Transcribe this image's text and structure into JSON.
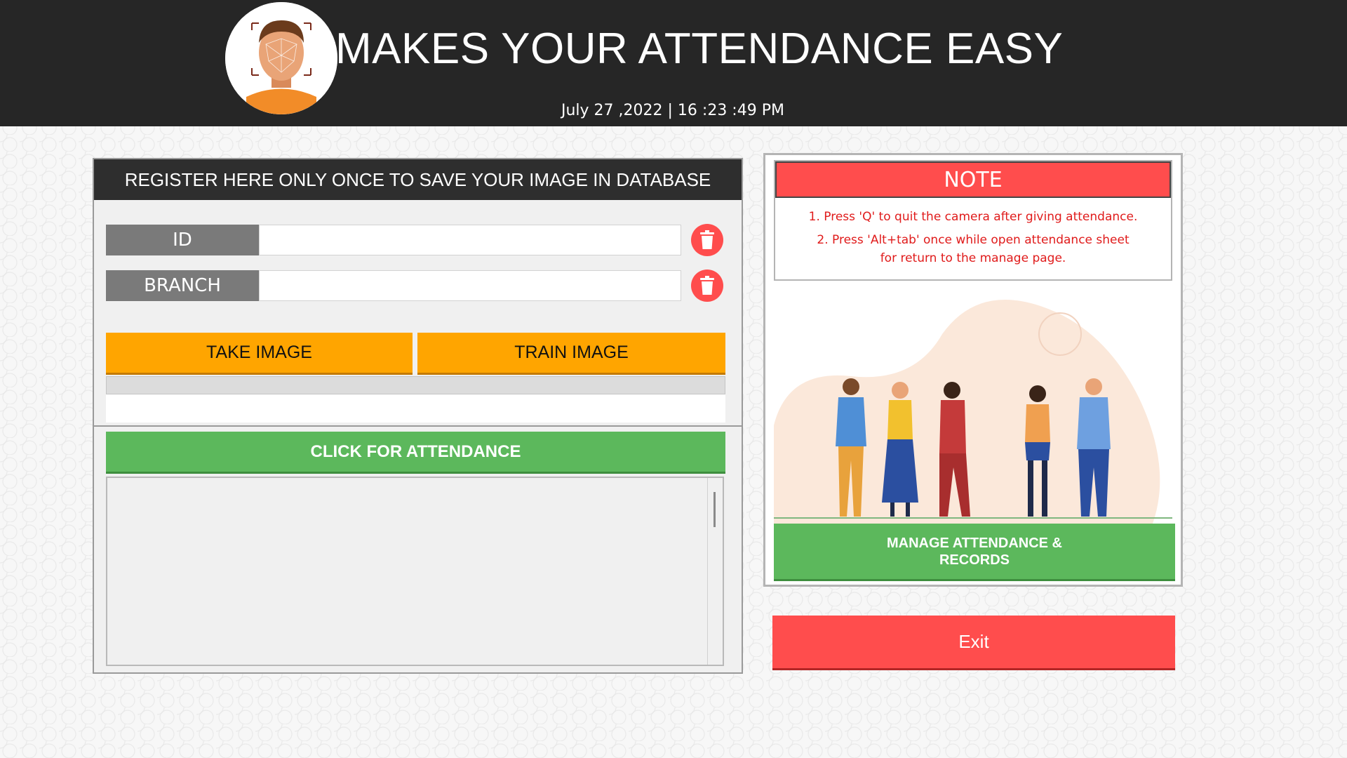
{
  "header": {
    "title": "MAKES YOUR ATTENDANCE EASY",
    "datetime": "July 27 ,2022 | 16 :23 :49 PM",
    "logo_icon": "face-recognition-logo-icon"
  },
  "register": {
    "heading": "REGISTER HERE ONLY ONCE TO SAVE YOUR IMAGE IN DATABASE",
    "fields": [
      {
        "label": "ID",
        "value": ""
      },
      {
        "label": "BRANCH",
        "value": ""
      }
    ],
    "clear_icon": "trash-icon",
    "take_image": "TAKE IMAGE",
    "train_image": "TRAIN IMAGE"
  },
  "attendance": {
    "button": "CLICK FOR ATTENDANCE"
  },
  "note": {
    "heading": "NOTE",
    "lines": [
      "1. Press 'Q' to quit the camera after giving attendance.",
      "2. Press 'Alt+tab' once while open attendance sheet",
      "for return to the manage page."
    ]
  },
  "manage_button": "MANAGE ATTENDANCE & RECORDS",
  "exit_button": "Exit",
  "colors": {
    "header_bg": "#262626",
    "orange": "#ffa500",
    "green": "#5cb85c",
    "red": "#ff4d4d",
    "note_text": "#e01b1b"
  }
}
